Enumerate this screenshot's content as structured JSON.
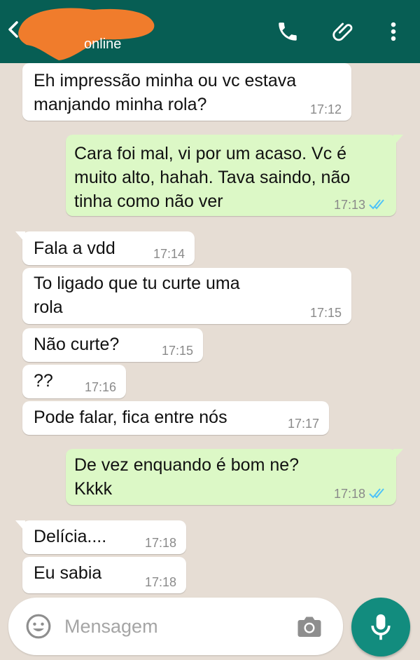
{
  "header": {
    "status": "online",
    "bg_color": "#075e54",
    "redaction_color": "#f07c2c",
    "icons": [
      "back-arrow-icon",
      "phone-icon",
      "paperclip-icon",
      "more-vert-icon"
    ]
  },
  "messages": [
    {
      "dir": "in",
      "text": "Eh impressão minha ou vc estava\nmanjando minha rola?",
      "time": "17:12"
    },
    {
      "dir": "out",
      "text": "Cara foi mal, vi por um acaso. Vc é\nmuito alto, hahah. Tava saindo, não\ntinha como não ver",
      "time": "17:13",
      "read": true
    },
    {
      "dir": "in",
      "text": "Fala a vdd",
      "time": "17:14"
    },
    {
      "dir": "in",
      "text": "To ligado que tu curte uma\nrola",
      "time": "17:15"
    },
    {
      "dir": "in",
      "text": "Não curte?",
      "time": "17:15"
    },
    {
      "dir": "in",
      "text": "??",
      "time": "17:16"
    },
    {
      "dir": "in",
      "text": "Pode falar, fica entre nós",
      "time": "17:17"
    },
    {
      "dir": "out",
      "text": "De vez enquando é bom ne?\nKkkk",
      "time": "17:18",
      "read": true
    },
    {
      "dir": "in",
      "text": "Delícia....",
      "time": "17:18"
    },
    {
      "dir": "in",
      "text": "Eu sabia",
      "time": "17:18"
    }
  ],
  "composer": {
    "placeholder": "Mensagem",
    "icons": [
      "emoji-icon",
      "camera-icon",
      "microphone-icon"
    ],
    "mic_color": "#128c7e"
  },
  "colors": {
    "incoming_bubble": "#ffffff",
    "outgoing_bubble": "#dcf8c6",
    "read_ticks": "#4fc3f7",
    "wallpaper": "#e6ddd4"
  }
}
